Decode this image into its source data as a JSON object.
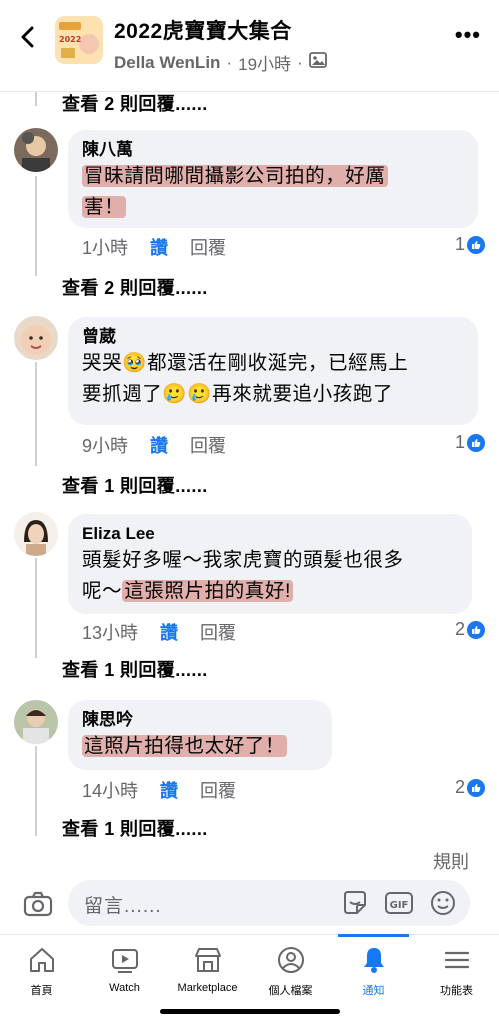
{
  "header": {
    "title": "2022虎寶寶大集合",
    "author": "Della WenLin",
    "time": "19小時",
    "dot": "·",
    "avatar_text": "2022虎寶寶"
  },
  "top_view_replies": "查看 2 則回覆......",
  "comments": [
    {
      "name": "陳八萬",
      "line1": "冒昧請問哪間攝影公司拍的，好厲",
      "line2": "害！",
      "time": "1小時",
      "like": "讚",
      "reply": "回覆",
      "reactions": "1",
      "view_replies": "查看 2 則回覆......"
    },
    {
      "name": "曾葳",
      "line1": "哭哭🥹都還活在剛收涎完，已經馬上",
      "line2": "要抓週了🥲🥲再來就要追小孩跑了",
      "time": "9小時",
      "like": "讚",
      "reply": "回覆",
      "reactions": "1",
      "view_replies": "查看 1 則回覆......"
    },
    {
      "name": "Eliza Lee",
      "line1": "頭髮好多喔～我家虎寶的頭髮也很多",
      "line2a": "呢～",
      "line2b": "這張照片拍的真好!",
      "time": "13小時",
      "like": "讚",
      "reply": "回覆",
      "reactions": "2",
      "view_replies": "查看 1 則回覆......"
    },
    {
      "name": "陳思吟",
      "line1": "這照片拍得也太好了！",
      "time": "14小時",
      "like": "讚",
      "reply": "回覆",
      "reactions": "2",
      "view_replies": "查看 1 則回覆......"
    }
  ],
  "rules": "規則",
  "composer": {
    "placeholder": "留言......",
    "gif": "GIF"
  },
  "tabs": [
    {
      "label": "首頁",
      "icon": "home-icon"
    },
    {
      "label": "Watch",
      "icon": "watch-icon"
    },
    {
      "label": "Marketplace",
      "icon": "marketplace-icon"
    },
    {
      "label": "個人檔案",
      "icon": "profile-icon"
    },
    {
      "label": "通知",
      "icon": "bell-icon",
      "active": true
    },
    {
      "label": "功能表",
      "icon": "menu-icon"
    }
  ],
  "colors": {
    "accent": "#1877f2",
    "bubble": "#f0f2f5",
    "highlight": "#d6786e"
  }
}
